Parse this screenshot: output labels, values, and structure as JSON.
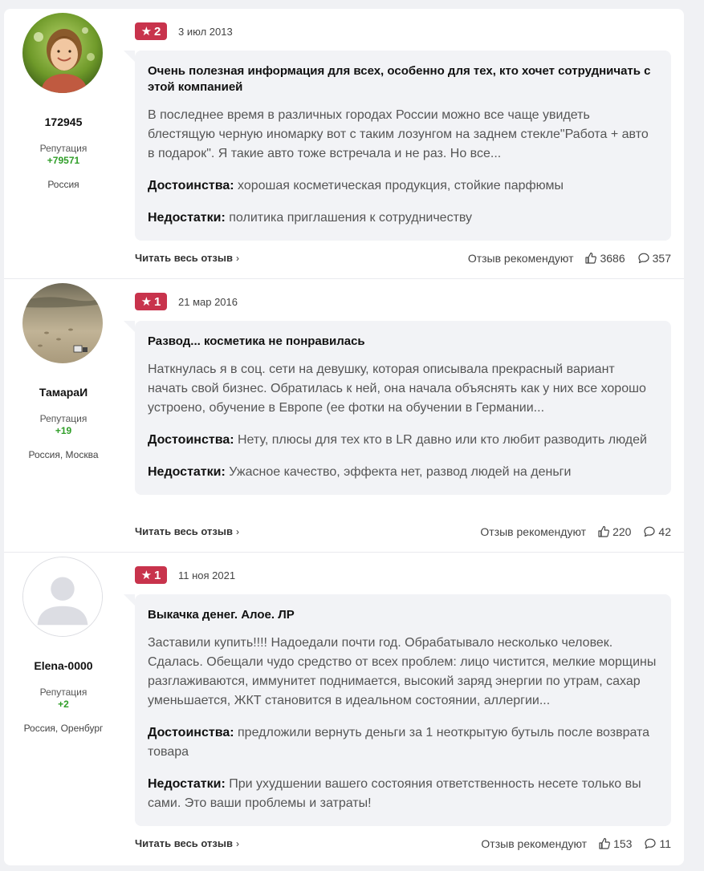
{
  "reviews": [
    {
      "author": "172945",
      "reputation_label": "Репутация",
      "reputation": "+79571",
      "location": "Россия",
      "rating": "2",
      "date": "3 июл 2013",
      "title": "Очень полезная информация для всех, особенно для тех, кто хочет сотрудничать с этой компанией",
      "text": "В последнее время в различных городах России можно все чаще увидеть блестящую черную иномарку вот с таким лозунгом на заднем стекле\"Работа + авто в подарок\". Я такие авто тоже встречала и не раз. Но все...",
      "pros_label": "Достоинства:",
      "pros": "хорошая косметическая продукция, стойкие парфюмы",
      "cons_label": "Недостатки:",
      "cons": "политика приглашения к сотрудничеству",
      "read_more": "Читать весь отзыв",
      "recommend": "Отзыв рекомендуют",
      "likes": "3686",
      "comments": "357",
      "avatar_icon": "photo-girl-avatar"
    },
    {
      "author": "ТамараИ",
      "reputation_label": "Репутация",
      "reputation": "+19",
      "location": "Россия, Москва",
      "rating": "1",
      "date": "21 мар 2016",
      "title": "Развод... косметика не понравилась",
      "text": "Наткнулась я в соц. сети на девушку, которая описывала прекрасный вариант начать свой бизнес. Обратилась к ней, она начала объяснять как у них все хорошо устроено, обучение в Европе (ее фотки на обучении в Германии...",
      "pros_label": "Достоинства:",
      "pros": "Нету, плюсы для тех кто в LR давно или кто любит разводить людей",
      "cons_label": "Недостатки:",
      "cons": "Ужасное качество, эффекта нет, развод людей на деньги",
      "read_more": "Читать весь отзыв",
      "recommend": "Отзыв рекомендуют",
      "likes": "220",
      "comments": "42",
      "avatar_icon": "photo-sand-avatar"
    },
    {
      "author": "Elena-0000",
      "reputation_label": "Репутация",
      "reputation": "+2",
      "location": "Россия, Оренбург",
      "rating": "1",
      "date": "11 ноя 2021",
      "title": "Выкачка денег. Алое. ЛР",
      "text": "Заставили купить!!!! Надоедали почти год. Обрабатывало несколько человек. Сдалась. Обещали чудо средство от всех проблем: лицо чистится, мелкие морщины разглаживаются, иммунитет поднимается, высокий заряд энергии по утрам, сахар уменьшается, ЖКТ становится в идеальном состоянии, аллергии...",
      "pros_label": "Достоинства:",
      "pros": "предложили вернуть деньги за 1 неоткрытую бутыль после возврата товара",
      "cons_label": "Недостатки:",
      "cons": "При ухудшении вашего состояния ответственность несете только вы сами. Это ваши проблемы и затраты!",
      "read_more": "Читать весь отзыв",
      "recommend": "Отзыв рекомендуют",
      "likes": "153",
      "comments": "11",
      "avatar_icon": "default-user-avatar"
    }
  ],
  "colors": {
    "rating_badge": "#c8334c",
    "reputation": "#2f9e28",
    "bubble": "#f2f3f6"
  }
}
